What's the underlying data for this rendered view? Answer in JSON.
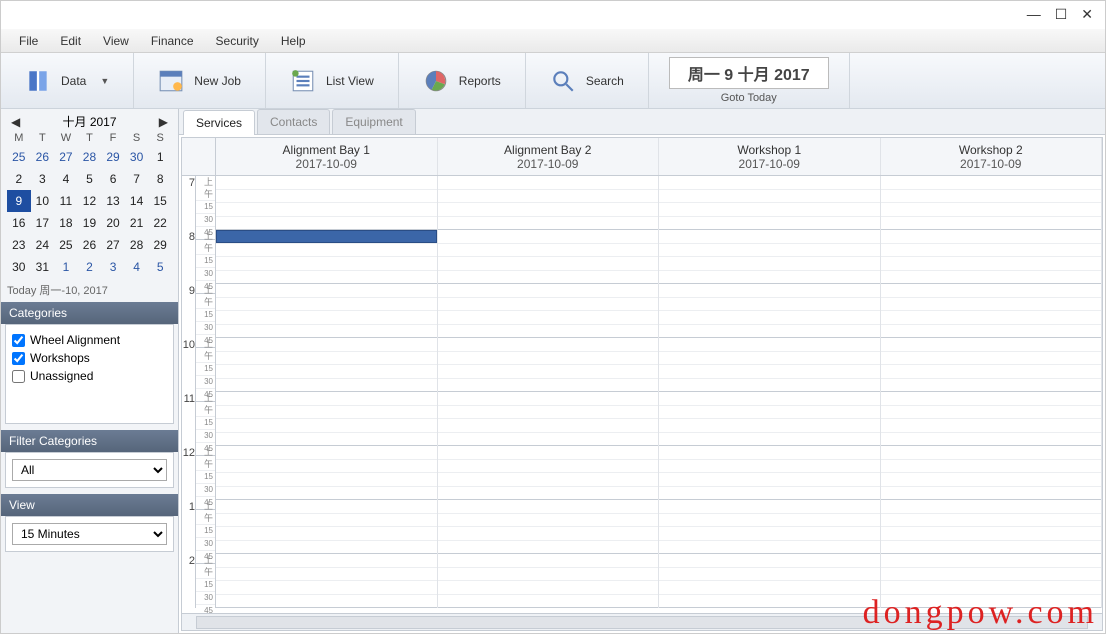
{
  "menu": {
    "items": [
      "File",
      "Edit",
      "View",
      "Finance",
      "Security",
      "Help"
    ]
  },
  "toolbar": {
    "data": "Data",
    "newjob": "New Job",
    "listview": "List View",
    "reports": "Reports",
    "search": "Search"
  },
  "goto": {
    "date": "周一 9 十月 2017",
    "label": "Goto Today"
  },
  "minical": {
    "title": "十月 2017",
    "dow": [
      "M",
      "T",
      "W",
      "T",
      "F",
      "S",
      "S"
    ],
    "weeks": [
      [
        {
          "d": 25,
          "o": true
        },
        {
          "d": 26,
          "o": true
        },
        {
          "d": 27,
          "o": true
        },
        {
          "d": 28,
          "o": true
        },
        {
          "d": 29,
          "o": true
        },
        {
          "d": 30,
          "o": true
        },
        {
          "d": 1,
          "o": false
        }
      ],
      [
        {
          "d": 2
        },
        {
          "d": 3
        },
        {
          "d": 4
        },
        {
          "d": 5
        },
        {
          "d": 6
        },
        {
          "d": 7
        },
        {
          "d": 8
        }
      ],
      [
        {
          "d": 9,
          "sel": true
        },
        {
          "d": 10
        },
        {
          "d": 11
        },
        {
          "d": 12
        },
        {
          "d": 13
        },
        {
          "d": 14
        },
        {
          "d": 15
        }
      ],
      [
        {
          "d": 16
        },
        {
          "d": 17
        },
        {
          "d": 18
        },
        {
          "d": 19
        },
        {
          "d": 20
        },
        {
          "d": 21
        },
        {
          "d": 22
        }
      ],
      [
        {
          "d": 23
        },
        {
          "d": 24
        },
        {
          "d": 25
        },
        {
          "d": 26
        },
        {
          "d": 27
        },
        {
          "d": 28
        },
        {
          "d": 29
        }
      ],
      [
        {
          "d": 30
        },
        {
          "d": 31
        },
        {
          "d": 1,
          "o": true
        },
        {
          "d": 2,
          "o": true
        },
        {
          "d": 3,
          "o": true
        },
        {
          "d": 4,
          "o": true
        },
        {
          "d": 5,
          "o": true
        }
      ]
    ],
    "today": "Today 周一-10, 2017"
  },
  "sections": {
    "categories": {
      "title": "Categories",
      "items": [
        {
          "label": "Wheel Alignment",
          "checked": true
        },
        {
          "label": "Workshops",
          "checked": true
        },
        {
          "label": "Unassigned",
          "checked": false
        }
      ]
    },
    "filter": {
      "title": "Filter Categories",
      "value": "All"
    },
    "view": {
      "title": "View",
      "value": "15 Minutes"
    }
  },
  "tabs": {
    "items": [
      "Services",
      "Contacts",
      "Equipment"
    ],
    "active": 0
  },
  "schedule": {
    "columns": [
      {
        "title": "Alignment Bay 1",
        "date": "2017-10-09"
      },
      {
        "title": "Alignment Bay 2",
        "date": "2017-10-09"
      },
      {
        "title": "Workshop 1",
        "date": "2017-10-09"
      },
      {
        "title": "Workshop 2",
        "date": "2017-10-09"
      }
    ],
    "hours": [
      7,
      8,
      9,
      10,
      11,
      12,
      1,
      2
    ],
    "sublabels": [
      "上午",
      "15",
      "30",
      "45"
    ],
    "appointment": {
      "hour": 8,
      "slot": 0,
      "col": 0
    }
  },
  "watermark": "dongpow.com"
}
